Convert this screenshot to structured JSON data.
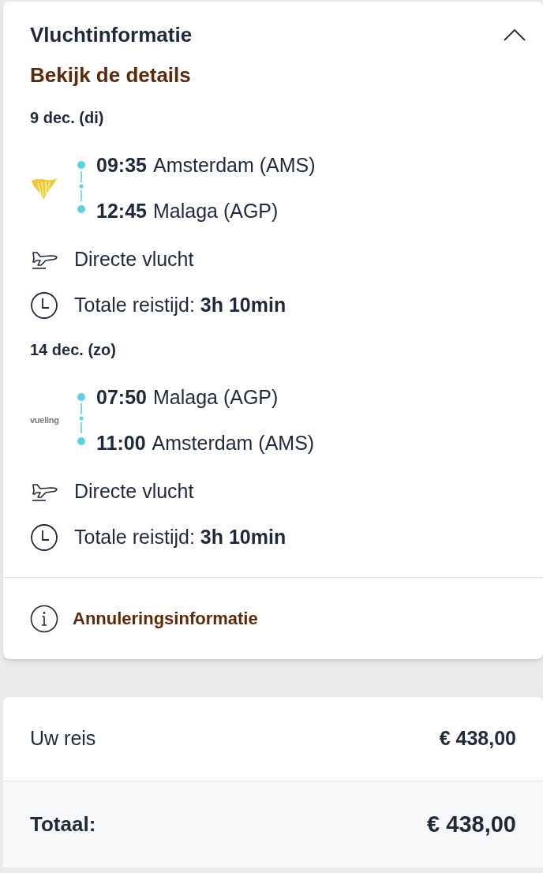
{
  "flight_card": {
    "title": "Vluchtinformatie",
    "expanded": true,
    "details_link": "Bekijk de details",
    "legs": [
      {
        "date": "9 dec. (di)",
        "airline_logo": {
          "kind": "harp"
        },
        "departure": {
          "time": "09:35",
          "place": "Amsterdam (AMS)"
        },
        "arrival": {
          "time": "12:45",
          "place": "Malaga (AGP)"
        },
        "flight_type": "Directe vlucht",
        "duration_label": "Totale reistijd:",
        "duration": "3h 10min"
      },
      {
        "date": "14 dec. (zo)",
        "airline_logo": {
          "kind": "wordmark",
          "text": "vueling"
        },
        "departure": {
          "time": "07:50",
          "place": "Malaga (AGP)"
        },
        "arrival": {
          "time": "11:00",
          "place": "Amsterdam (AMS)"
        },
        "flight_type": "Directe vlucht",
        "duration_label": "Totale reistijd:",
        "duration": "3h 10min"
      }
    ],
    "cancellation_link": "Annuleringsinformatie"
  },
  "price_card": {
    "rows": [
      {
        "label": "Uw reis",
        "amount": "€ 438,00",
        "kind": "item"
      },
      {
        "label": "Totaal:",
        "amount": "€ 438,00",
        "kind": "total"
      }
    ]
  }
}
